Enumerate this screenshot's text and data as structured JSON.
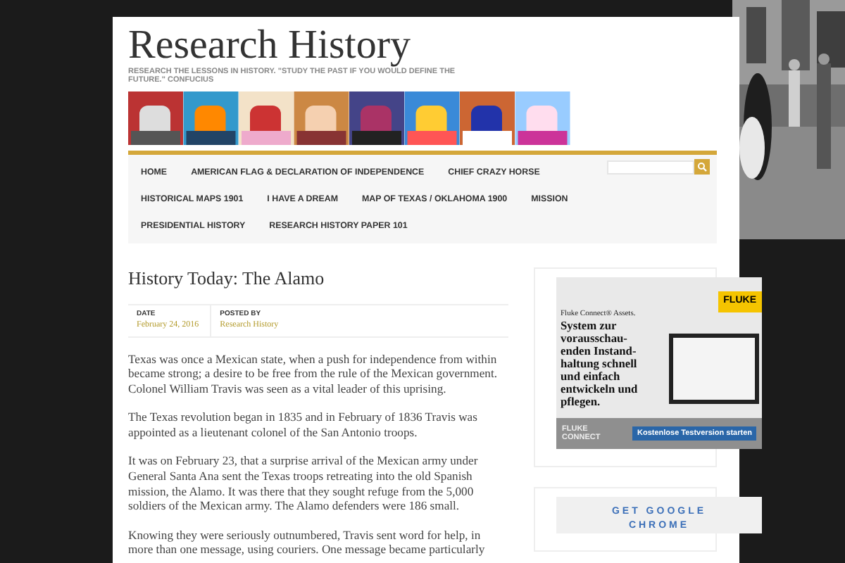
{
  "site": {
    "title": "Research History",
    "tagline": "RESEARCH THE LESSONS IN HISTORY. \"STUDY THE PAST IF YOU WOULD DEFINE THE FUTURE.\" CONFUCIUS"
  },
  "nav": {
    "rows": [
      [
        "HOME",
        "AMERICAN FLAG & DECLARATION OF INDEPENDENCE",
        "CHIEF CRAZY HORSE"
      ],
      [
        "HISTORICAL MAPS 1901",
        "I HAVE A DREAM",
        "MAP OF TEXAS / OKLAHOMA 1900",
        "MISSION"
      ],
      [
        "PRESIDENTIAL HISTORY",
        "RESEARCH HISTORY PAPER 101"
      ]
    ]
  },
  "post": {
    "title": "History Today: The Alamo",
    "meta": [
      {
        "label": "DATE",
        "value": "February 24, 2016"
      },
      {
        "label": "POSTED BY",
        "value": "Research History"
      }
    ],
    "paragraphs": [
      "Texas was once a Mexican state, when a push for independence from within became strong; a desire to be free from the rule of the Mexican government. Colonel William Travis was seen as a vital leader of this uprising.",
      "The Texas revolution began in 1835 and in February of 1836 Travis was appointed as a lieutenant colonel of the San Antonio troops.",
      "It was on February 23, that a surprise arrival of the Mexican army under General Santa Ana sent the Texas troops retreating into the old Spanish mission, the Alamo. It was there that they sought refuge from the 5,000 soldiers of the Mexican army. The Alamo defenders were 186 small.",
      "Knowing they were seriously outnumbered, Travis sent word for help, in more than one message, using couriers. One message became particularly"
    ]
  },
  "ads": [
    {
      "kind": "fluke",
      "brand": "FLUKE",
      "headline": "Fluke Connect® Assets.",
      "body": "System zur vorausschau-enden Instand-haltung schnell und einfach entwickeln und pflegen.",
      "logo": "FLUKE CONNECT",
      "button": "Kostenlose Testversion starten"
    },
    {
      "kind": "chrome",
      "text": "GET GOOGLE CHROME"
    }
  ]
}
